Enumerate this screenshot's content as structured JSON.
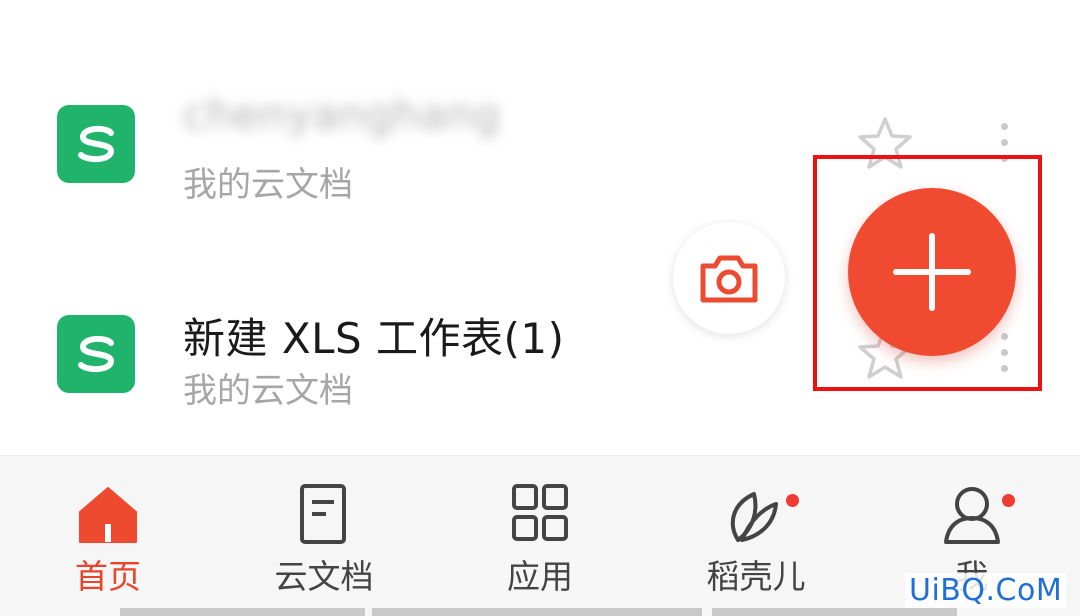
{
  "files": [
    {
      "name": "chenyanghang",
      "location": "我的云文档",
      "icon": "wps-spreadsheet-icon",
      "icon_color": "#1fb36b",
      "name_obscured": true
    },
    {
      "name": "新建 XLS 工作表(1)",
      "location": "我的云文档",
      "icon": "wps-spreadsheet-icon",
      "icon_color": "#1fb36b"
    }
  ],
  "actions": {
    "camera_icon": "camera-icon",
    "new_icon": "plus-icon",
    "accent_color": "#f04a30",
    "highlight_color": "#ee1111"
  },
  "bottom_nav": {
    "items": [
      {
        "label": "首页",
        "icon": "home-icon",
        "active": true
      },
      {
        "label": "云文档",
        "icon": "document-icon",
        "active": false
      },
      {
        "label": "应用",
        "icon": "apps-grid-icon",
        "active": false
      },
      {
        "label": "稻壳儿",
        "icon": "leaf-icon",
        "active": false,
        "badge": true
      },
      {
        "label": "我",
        "icon": "profile-icon",
        "active": false,
        "badge": true
      }
    ],
    "active_color": "#e8442c"
  },
  "watermark": {
    "text": "UiBQ.CoM"
  }
}
